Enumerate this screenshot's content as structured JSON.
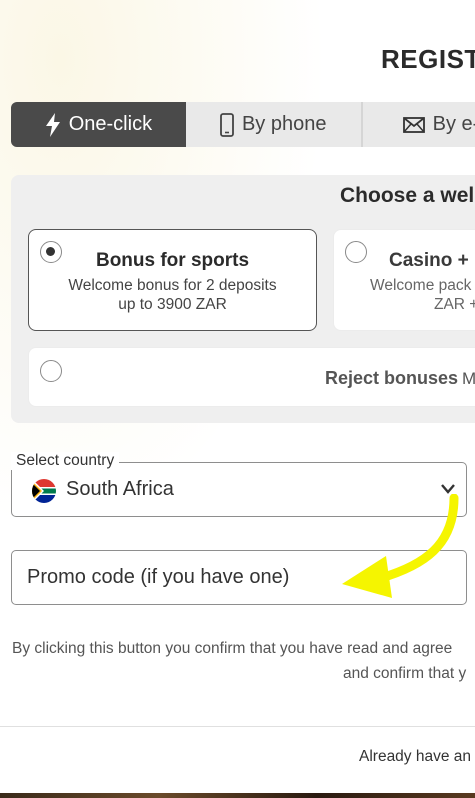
{
  "header": {
    "title": "REGIST"
  },
  "tabs": [
    {
      "label": "One-click",
      "icon": "lightning-icon",
      "active": true
    },
    {
      "label": "By phone",
      "icon": "phone-icon",
      "active": false
    },
    {
      "label": "By e-",
      "icon": "envelope-icon",
      "active": false
    }
  ],
  "bonus": {
    "heading": "Choose a welc",
    "options": [
      {
        "title": "Bonus for sports",
        "line1": "Welcome bonus for 2 deposits",
        "line2": "up to 3900 ZAR",
        "selected": true
      },
      {
        "title": "Casino + M",
        "line1": "Welcome pack",
        "line2": "ZAR +",
        "selected": false
      },
      {
        "title": "Reject bonuses",
        "extra": "M",
        "selected": false
      }
    ]
  },
  "country": {
    "label": "Select country",
    "value": "South Africa",
    "flag": "south-africa-flag"
  },
  "promo": {
    "placeholder": "Promo code (if you have one)"
  },
  "disclaimer": {
    "line1": "By clicking this button you confirm that you have read and agree",
    "line2": "and confirm that y"
  },
  "footer": {
    "login_text": "Already have an"
  },
  "colors": {
    "active_tab": "#4a4a4a",
    "arrow": "#f5f500",
    "panel_bg": "#efefef"
  }
}
